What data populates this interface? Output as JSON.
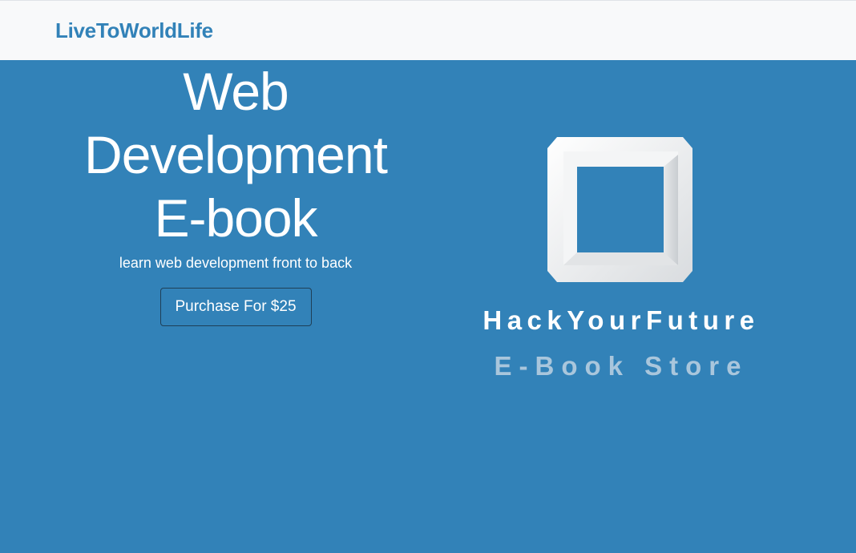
{
  "navbar": {
    "brand": "LiveToWorldLife"
  },
  "hero": {
    "title_lines": [
      "Web",
      "Development",
      "E-book"
    ],
    "subtitle": "learn web development front to back",
    "purchase_button": "Purchase For $25"
  },
  "logo": {
    "name": "HackYourFuture",
    "tagline": "E-Book Store",
    "icon": "square-frame-icon"
  },
  "colors": {
    "hero_bg": "#3282b8",
    "navbar_bg": "#f8f9fa",
    "brand": "#3282b8",
    "tagline": "#a9c6dc"
  }
}
